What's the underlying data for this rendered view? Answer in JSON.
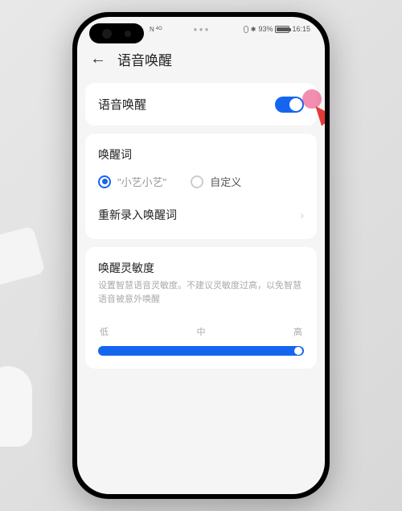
{
  "status_bar": {
    "network_icon": "N",
    "network_sub": "4G",
    "notif": "● ● ●",
    "battery_percent": "93%",
    "time": "16:15"
  },
  "header": {
    "title": "语音唤醒"
  },
  "voice_wake": {
    "label": "语音唤醒",
    "enabled": true
  },
  "wake_word": {
    "section_title": "唤醒词",
    "option1": "\"小艺小艺\"",
    "option2": "自定义",
    "rerecord_label": "重新录入唤醒词"
  },
  "sensitivity": {
    "title": "唤醒灵敏度",
    "description": "设置智慧语音灵敏度。不建议灵敏度过高，以免智慧语音被意外唤醒",
    "low": "低",
    "mid": "中",
    "high": "高"
  }
}
